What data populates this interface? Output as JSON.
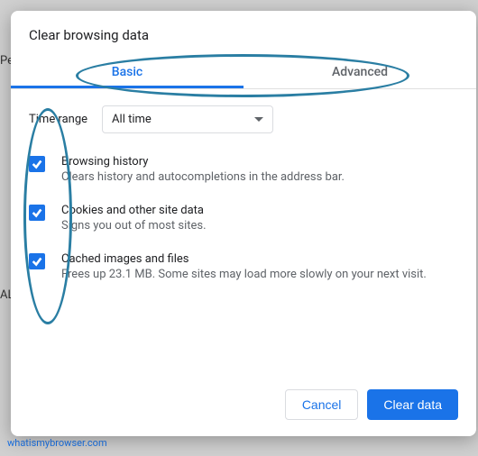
{
  "dialog": {
    "title": "Clear browsing data",
    "tabs": {
      "basic": "Basic",
      "advanced": "Advanced"
    },
    "timerange": {
      "label": "Time range",
      "value": "All time"
    },
    "items": [
      {
        "title": "Browsing history",
        "desc": "Clears history and autocompletions in the address bar."
      },
      {
        "title": "Cookies and other site data",
        "desc": "Signs you out of most sites."
      },
      {
        "title": "Cached images and files",
        "desc": "Frees up 23.1 MB. Some sites may load more slowly on your next visit."
      }
    ],
    "buttons": {
      "cancel": "Cancel",
      "clear": "Clear data"
    }
  },
  "background": {
    "left1": "Pe",
    "left2": "AL",
    "footer": "whatismybrowser.com"
  }
}
